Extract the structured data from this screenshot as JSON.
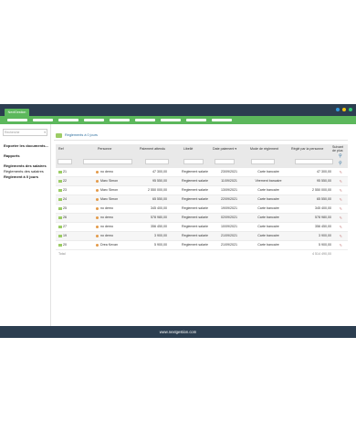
{
  "brand": "NextGestion",
  "window_dots": [
    "#3498db",
    "#f1c40f",
    "#2ecc71"
  ],
  "nav_items_count": 9,
  "sidebar": {
    "search_placeholder": "Recherche",
    "links": [
      {
        "label": "Exporter les documents...",
        "bold": true
      },
      {
        "label": "Rapports",
        "bold": true
      },
      {
        "label": "Règlements des salaires",
        "bold": true
      },
      {
        "label": "Règlements des salaires",
        "bold": false
      },
      {
        "label": "Règlement à 0 jours",
        "bold": true
      }
    ]
  },
  "breadcrumb": "Reglements à 0 jours",
  "table": {
    "headers": [
      "Ref",
      "Personne",
      "Paiement attendu",
      "Libellé",
      "Date paiement ▾",
      "Mode de règlement",
      "Réglé par la personne",
      "Suivant de plus"
    ],
    "rows": [
      [
        "21",
        "no demo",
        "47 300,00",
        "Reglement salarie",
        "23/09/2021",
        "Carte bancaire",
        "47 300,00"
      ],
      [
        "22",
        "Marc Simon",
        "95 550,00",
        "Reglement salarie",
        "11/09/2021",
        "Virement bancaire",
        "95 550,00"
      ],
      [
        "23",
        "Marc Simon",
        "2 550 000,00",
        "Reglement salarie",
        "13/09/2021",
        "Carte bancaire",
        "2 550 000,00"
      ],
      [
        "24",
        "Marc Simon",
        "65 550,00",
        "Reglement salarie",
        "22/09/2021",
        "Carte bancaire",
        "65 550,00"
      ],
      [
        "25",
        "no demo",
        "345 400,00",
        "Reglement salarie",
        "19/09/2021",
        "Carte bancaire",
        "345 400,00"
      ],
      [
        "26",
        "no demo",
        "578 980,00",
        "Reglement salarie",
        "02/09/2021",
        "Carte bancaire",
        "578 980,00"
      ],
      [
        "27",
        "no demo",
        "356 450,00",
        "Reglement salarie",
        "10/09/2021",
        "Carte bancaire",
        "356 450,00"
      ],
      [
        "19",
        "no demo",
        "3 900,00",
        "Reglement salarie",
        "21/09/2021",
        "Carte bancaire",
        "3 900,00"
      ],
      [
        "20",
        "Drea Kevan",
        "5 900,00",
        "Reglement salarie",
        "21/09/2021",
        "Carte bancaire",
        "5 900,00"
      ]
    ],
    "total_label": "Total",
    "total_value": "4 514 490,00"
  },
  "footer": "www.nextgestion.com"
}
